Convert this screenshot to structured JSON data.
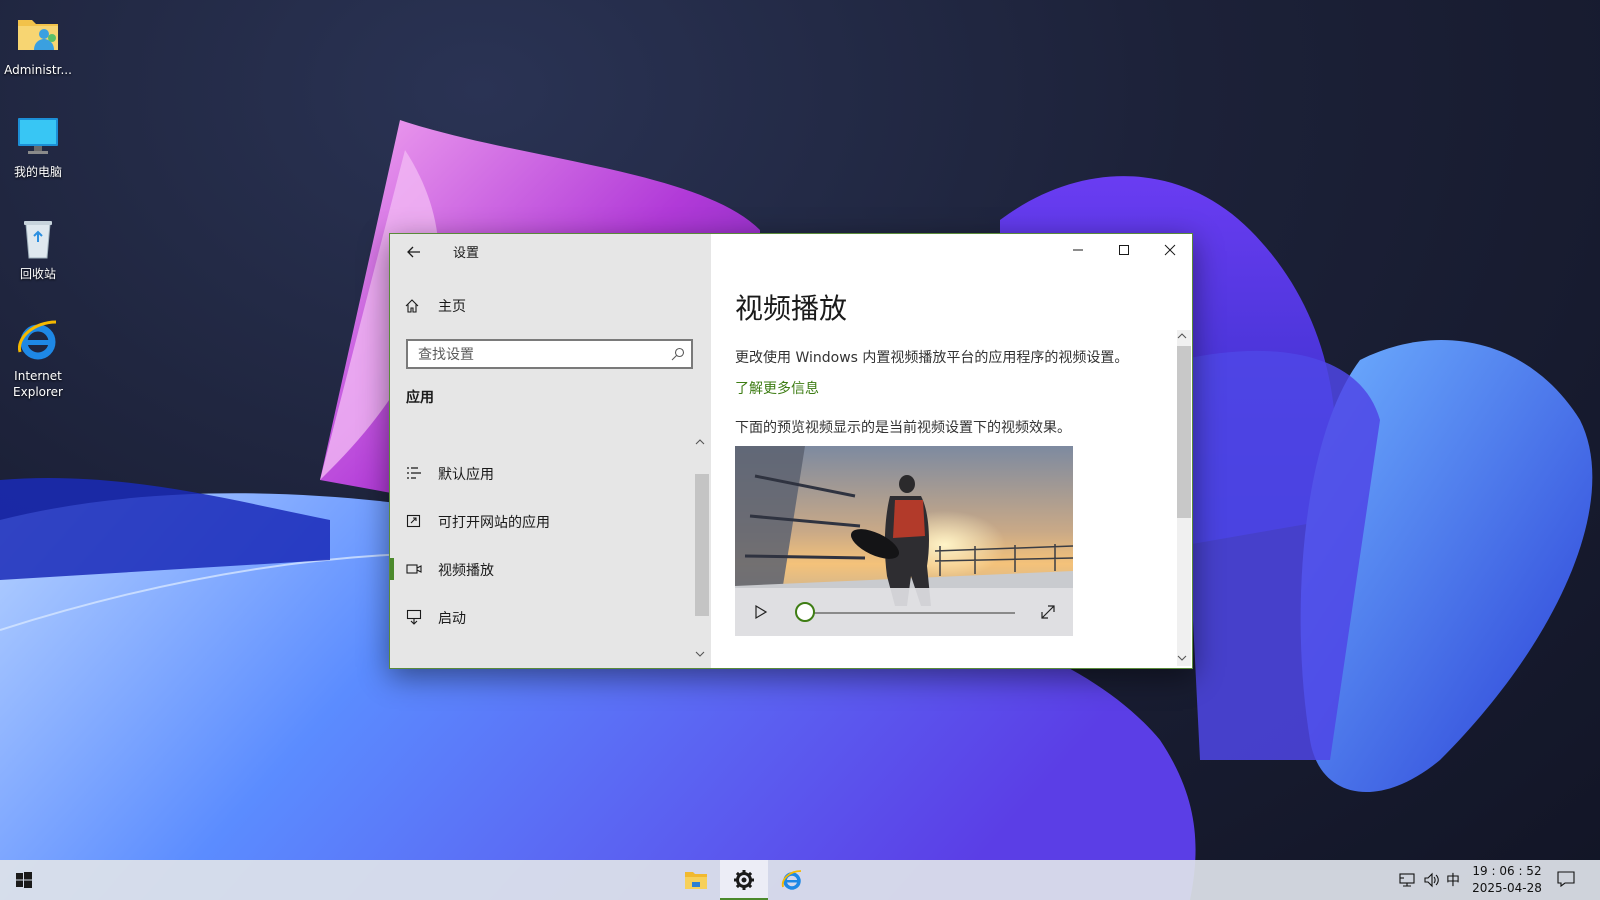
{
  "desktop": {
    "icons": [
      {
        "label": "Administr...",
        "icon": "user-folder-icon"
      },
      {
        "label": "我的电脑",
        "icon": "monitor-icon"
      },
      {
        "label": "回收站",
        "icon": "recycle-bin-icon"
      },
      {
        "label": "Internet Explorer",
        "icon": "ie-icon"
      }
    ]
  },
  "window": {
    "title": "设置",
    "controls": [
      "minimize-icon",
      "maximize-icon",
      "close-icon"
    ]
  },
  "sidebar": {
    "home_label": "主页",
    "search_placeholder": "查找设置",
    "section_header": "应用",
    "items": [
      {
        "label": "默认应用",
        "icon": "default-apps-icon"
      },
      {
        "label": "可打开网站的应用",
        "icon": "apps-for-websites-icon"
      },
      {
        "label": "视频播放",
        "icon": "video-icon",
        "selected": true
      },
      {
        "label": "启动",
        "icon": "startup-icon"
      }
    ]
  },
  "content": {
    "title": "视频播放",
    "description": "更改使用 Windows 内置视频播放平台的应用程序的视频设置。",
    "learn_more": "了解更多信息",
    "preview_caption": "下面的预览视频显示的是当前视频设置下的视频效果。",
    "video": {
      "progress": 0.0
    }
  },
  "taskbar": {
    "pinned": [
      "file-explorer-icon",
      "settings-icon",
      "ie-icon"
    ],
    "active": "settings-icon",
    "ime": "中",
    "time": "19 : 06 : 52",
    "date": "2025-04-28"
  },
  "colors": {
    "accent": "#4c8a2c",
    "link": "#3e7d14",
    "sidebar_bg": "#e6e6e6"
  }
}
